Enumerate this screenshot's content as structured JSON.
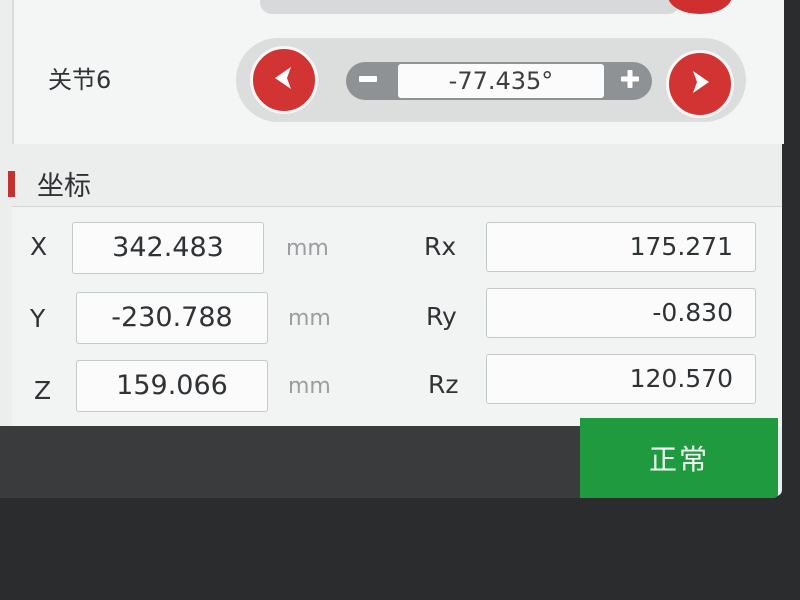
{
  "joint": {
    "label": "关节6",
    "value": "-77.435°",
    "decrease_icon": "chevron-left-icon",
    "increase_icon": "chevron-right-icon",
    "minus_icon": "minus-icon",
    "plus_icon": "plus-icon"
  },
  "coordinates": {
    "title": "坐标",
    "rows": [
      {
        "axis": "X",
        "value": "342.483",
        "unit": "mm",
        "rot_axis": "Rx",
        "rot_value": "175.271"
      },
      {
        "axis": "Y",
        "value": "-230.788",
        "unit": "mm",
        "rot_axis": "Ry",
        "rot_value": "-0.830"
      },
      {
        "axis": "Z",
        "value": "159.066",
        "unit": "mm",
        "rot_axis": "Rz",
        "rot_value": "120.570"
      }
    ]
  },
  "status": {
    "label": "正常",
    "color": "#1f9a3f"
  },
  "colors": {
    "accent": "#d23434",
    "panel": "#eceeee"
  }
}
